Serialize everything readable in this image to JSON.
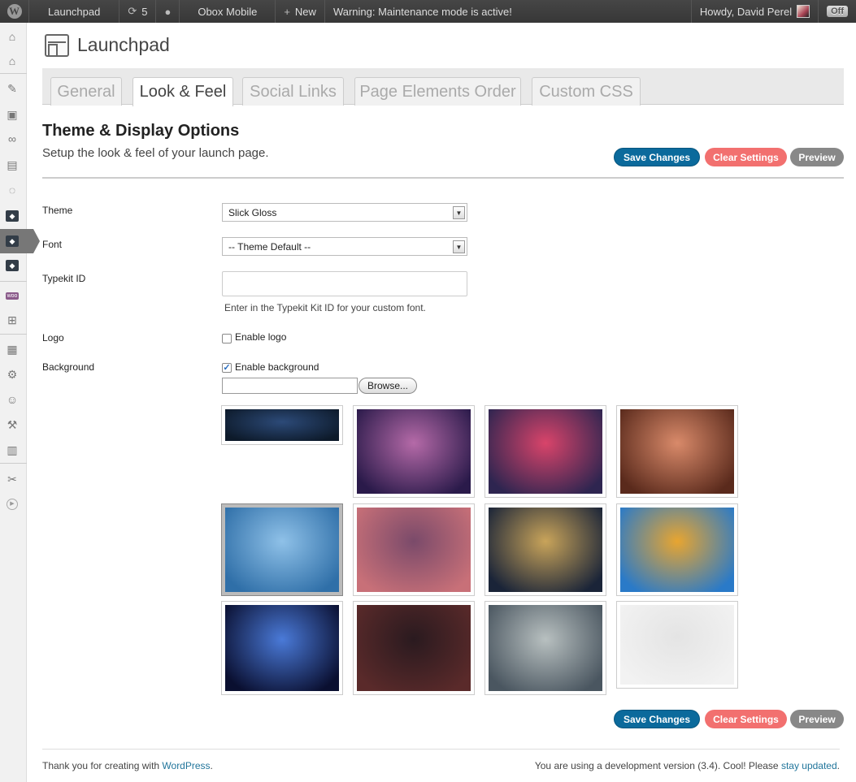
{
  "admin_bar": {
    "site_name": "Launchpad",
    "updates_count": "5",
    "site_link": "Obox Mobile",
    "new_label": "New",
    "warning": "Warning: Maintenance mode is active!",
    "greeting": "Howdy, David Perel",
    "toggle_label": "Off"
  },
  "page": {
    "title": "Launchpad",
    "tabs": [
      {
        "label": "General"
      },
      {
        "label": "Look & Feel"
      },
      {
        "label": "Social Links"
      },
      {
        "label": "Page Elements Order"
      },
      {
        "label": "Custom CSS"
      }
    ],
    "active_tab": "Look & Feel"
  },
  "section": {
    "title": "Theme & Display Options",
    "description": "Setup the look & feel of your launch page."
  },
  "buttons": {
    "save": "Save Changes",
    "clear": "Clear Settings",
    "preview": "Preview"
  },
  "form": {
    "theme": {
      "label": "Theme",
      "value": "Slick Gloss"
    },
    "font": {
      "label": "Font",
      "value": "-- Theme Default --"
    },
    "typekit": {
      "label": "Typekit ID",
      "value": "",
      "help": "Enter in the Typekit Kit ID for your custom font."
    },
    "logo": {
      "label": "Logo",
      "checkbox_label": "Enable logo",
      "checked": false
    },
    "background": {
      "label": "Background",
      "checkbox_label": "Enable background",
      "checked": true,
      "browse_label": "Browse..."
    }
  },
  "backgrounds": {
    "selected_index": 4,
    "colors": [
      [
        "#0d1a2a",
        "#2c4a78"
      ],
      [
        "#2a1a4a",
        "#b56aa8"
      ],
      [
        "#2e2550",
        "#d9446a"
      ],
      [
        "#5a2a1c",
        "#d98a6a"
      ],
      [
        "#2f6fa8",
        "#8fc1e8"
      ],
      [
        "#c87078",
        "#7a4a6a"
      ],
      [
        "#1a2438",
        "#c9a45a"
      ],
      [
        "#2a7ac8",
        "#e8a530"
      ],
      [
        "#0a0f30",
        "#4a7ad8"
      ],
      [
        "#5a2a2a",
        "#2a1a1f"
      ],
      [
        "#4a5660",
        "#b8c0c0"
      ],
      [
        "#f2f2f2",
        "#e4e4e4"
      ]
    ]
  },
  "footer": {
    "left_text": "Thank you for creating with ",
    "left_link": "WordPress",
    "left_suffix": ".",
    "right_text": "You are using a development version (3.4). Cool! Please ",
    "right_link": "stay updated",
    "right_suffix": "."
  }
}
